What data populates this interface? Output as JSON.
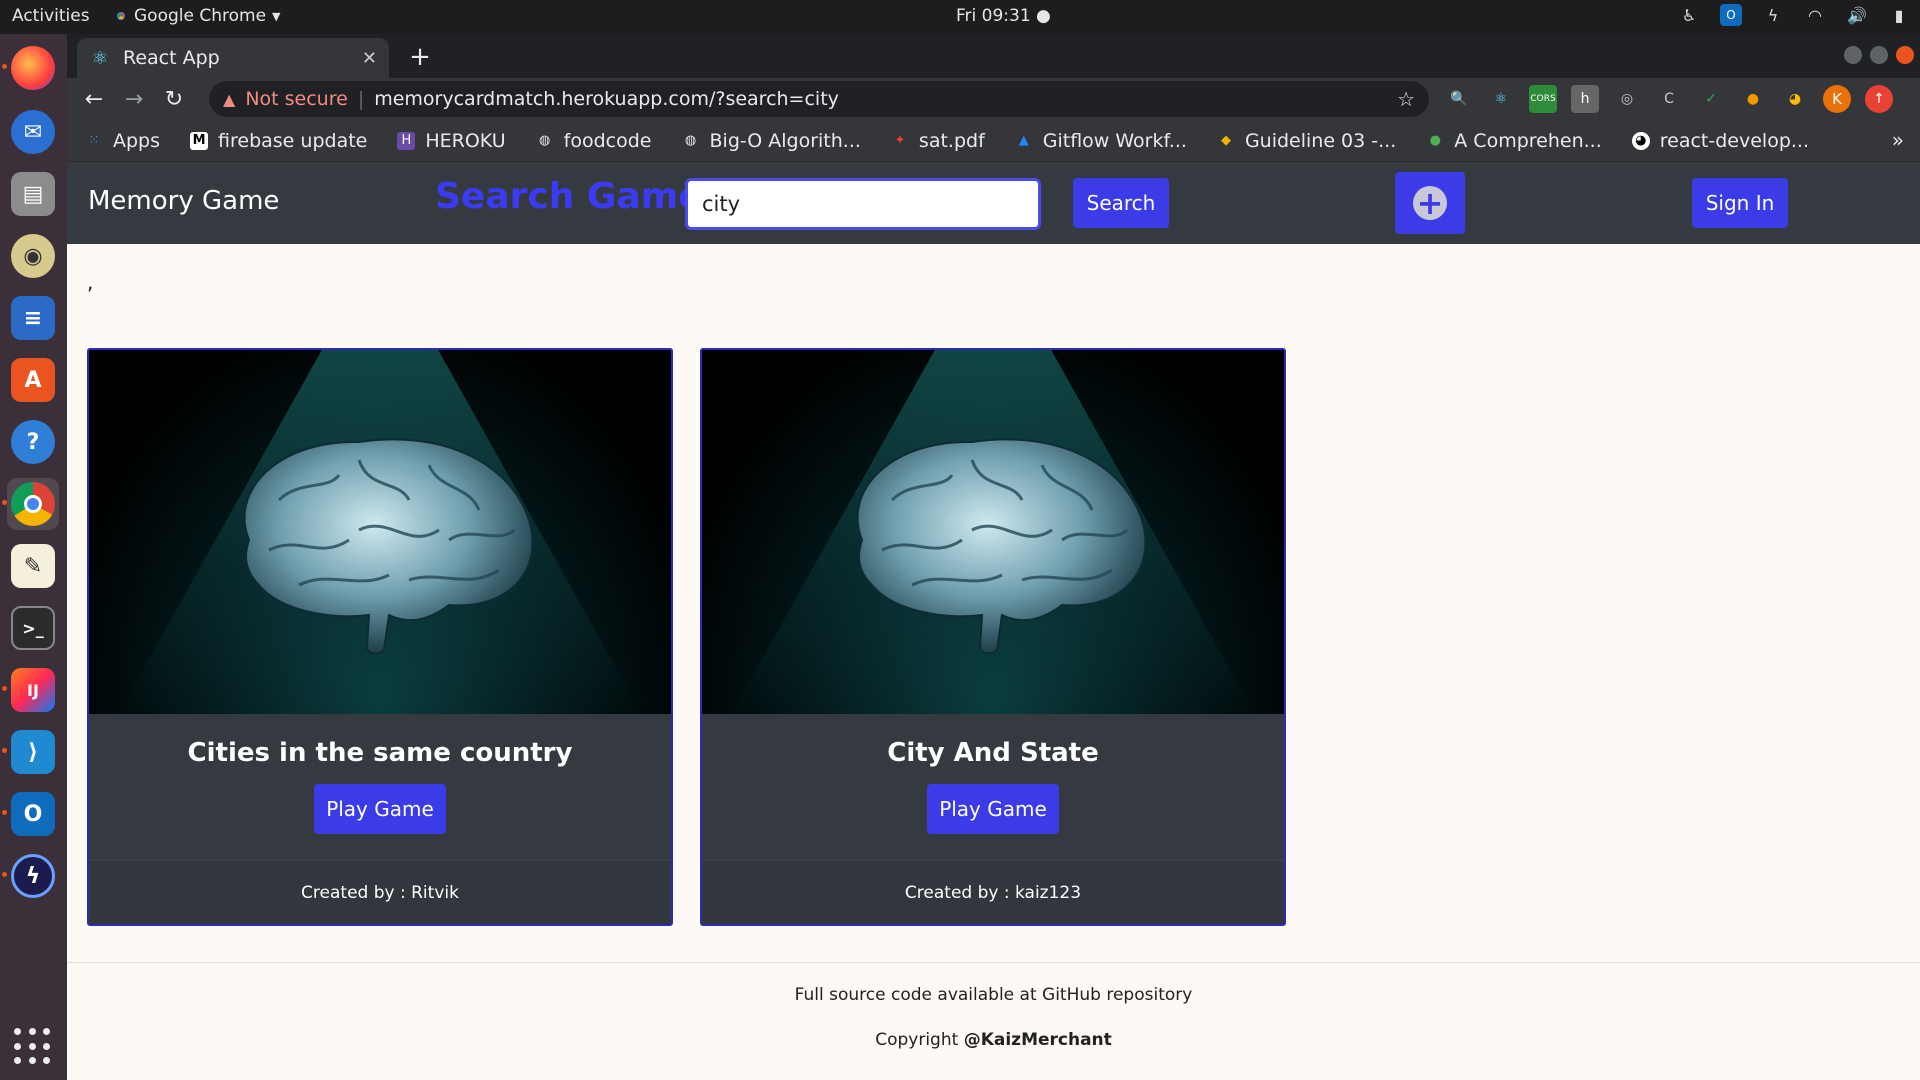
{
  "os": {
    "activities": "Activities",
    "app_name": "Google Chrome",
    "clock": "Fri 09:31 ●"
  },
  "browser": {
    "tab_title": "React App",
    "security_label": "Not secure",
    "url": "memorycardmatch.herokuapp.com/?search=city",
    "profile_initial": "K",
    "bookmarks": [
      {
        "label": "Apps"
      },
      {
        "label": "firebase update"
      },
      {
        "label": "HEROKU"
      },
      {
        "label": "foodcode"
      },
      {
        "label": "Big-O Algorith..."
      },
      {
        "label": "sat.pdf"
      },
      {
        "label": "Gitflow Workf..."
      },
      {
        "label": "Guideline 03 -..."
      },
      {
        "label": "A Comprehen..."
      },
      {
        "label": "react-develop..."
      }
    ]
  },
  "app": {
    "brand": "Memory Game",
    "search_title": "Search Game",
    "search_value": "city",
    "search_button": "Search",
    "signin_button": "Sign In",
    "plus_symbol": "+",
    "stray_text": ",",
    "cards": [
      {
        "title": "Cities in the same country",
        "button": "Play Game",
        "creator": "Created by : Ritvik"
      },
      {
        "title": "City And State",
        "button": "Play Game",
        "creator": "Created by : kaiz123"
      }
    ],
    "footer": {
      "line1": "Full source code available at GitHub repository",
      "copyright_prefix": "Copyright ",
      "copyright_handle": "@KaizMerchant"
    }
  },
  "colors": {
    "accent": "#3b3be8",
    "navbar": "#343a40",
    "page_bg": "#fdf9f5"
  }
}
